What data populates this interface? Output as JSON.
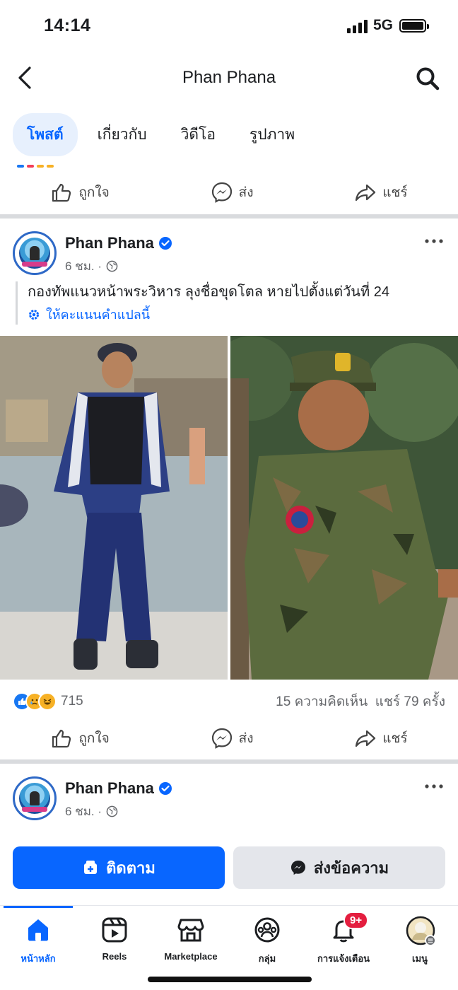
{
  "status_bar": {
    "time": "14:14",
    "network": "5G"
  },
  "header": {
    "title": "Phan Phana"
  },
  "tabs": [
    {
      "label": "โพสต์",
      "active": true
    },
    {
      "label": "เกี่ยวกับ",
      "active": false
    },
    {
      "label": "วิดีโอ",
      "active": false
    },
    {
      "label": "รูปภาพ",
      "active": false
    }
  ],
  "actions": {
    "like": "ถูกใจ",
    "send": "ส่ง",
    "share": "แชร์"
  },
  "post1": {
    "author": "Phan Phana",
    "time": "6 ชม. ·",
    "text": "กองทัพแนวหน้าพระวิหาร ลุงชื่อขุดโตล หายไปตั้งแต่วันที่ 24",
    "rate_translation": "ให้คะแนนคำแปลนี้",
    "reaction_count": "715",
    "comments_shares": "15 ความคิดเห็น  แชร์ 79 ครั้ง"
  },
  "post2": {
    "author": "Phan Phana",
    "time": "6 ชม. ·"
  },
  "buttons": {
    "follow": "ติดตาม",
    "message": "ส่งข้อความ"
  },
  "bottom_nav": [
    {
      "label": "หน้าหลัก",
      "icon": "home-icon",
      "active": true
    },
    {
      "label": "Reels",
      "icon": "reels-icon",
      "active": false
    },
    {
      "label": "Marketplace",
      "icon": "marketplace-icon",
      "active": false
    },
    {
      "label": "กลุ่ม",
      "icon": "groups-icon",
      "active": false
    },
    {
      "label": "การแจ้งเตือน",
      "icon": "bell-icon",
      "active": false,
      "badge": "9+"
    },
    {
      "label": "เมนู",
      "icon": "menu-avatar-icon",
      "active": false
    }
  ],
  "colors": {
    "accent": "#0866ff",
    "badge": "#e41e3f",
    "divider": "#d9dbde"
  }
}
